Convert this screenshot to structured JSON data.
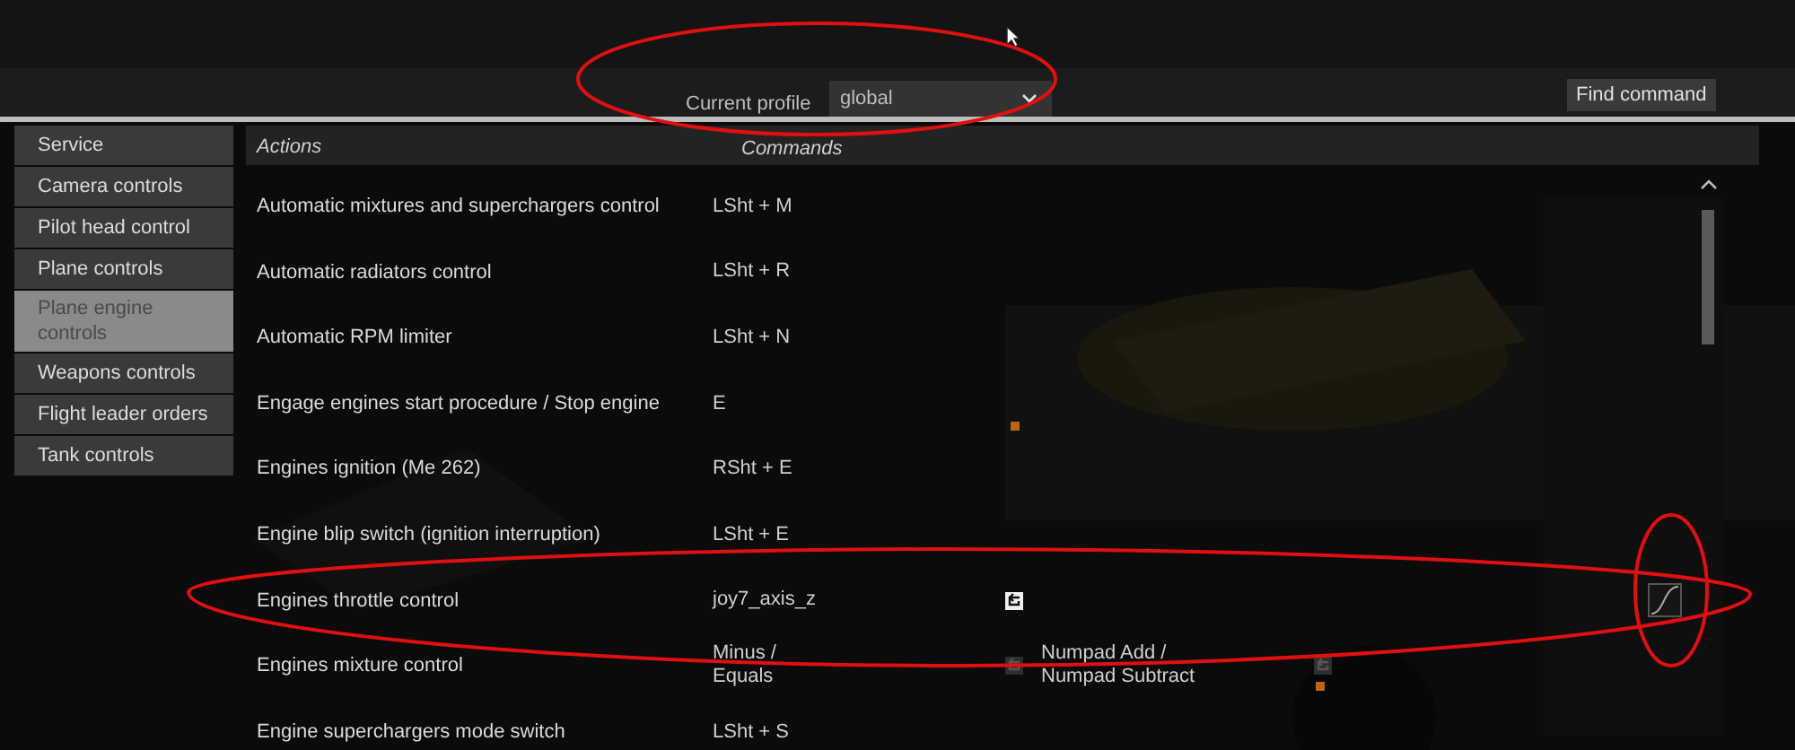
{
  "profile": {
    "label": "Current profile",
    "value": "global"
  },
  "find_button": "Find command",
  "sidebar": {
    "items": [
      {
        "label": "Service",
        "selected": false
      },
      {
        "label": "Camera controls",
        "selected": false
      },
      {
        "label": "Pilot head control",
        "selected": false
      },
      {
        "label": "Plane controls",
        "selected": false
      },
      {
        "label": "Plane engine controls",
        "selected": true
      },
      {
        "label": "Weapons controls",
        "selected": false
      },
      {
        "label": "Flight leader orders",
        "selected": false
      },
      {
        "label": "Tank controls",
        "selected": false
      }
    ]
  },
  "table": {
    "columns": [
      "Actions",
      "Commands"
    ],
    "rows": [
      {
        "action": "Automatic mixtures and superchargers control",
        "commands": [
          {
            "text": "LSht + M"
          }
        ]
      },
      {
        "action": "Automatic radiators control",
        "commands": [
          {
            "text": "LSht + R"
          }
        ]
      },
      {
        "action": "Automatic RPM limiter",
        "commands": [
          {
            "text": "LSht + N"
          }
        ]
      },
      {
        "action": "Engage engines start procedure / Stop engine",
        "commands": [
          {
            "text": "E"
          }
        ]
      },
      {
        "action": "Engines ignition (Me 262)",
        "commands": [
          {
            "text": "RSht + E"
          }
        ]
      },
      {
        "action": "Engine blip switch (ignition interruption)",
        "commands": [
          {
            "text": "LSht + E"
          }
        ]
      },
      {
        "action": "Engines throttle control",
        "commands": [
          {
            "text": "joy7_axis_z",
            "inverted": true
          }
        ],
        "curve": true
      },
      {
        "action": "Engines mixture control",
        "commands": [
          {
            "text": "Minus / Equals",
            "inverted": false
          },
          {
            "text": "Numpad Add / Numpad Subtract",
            "inverted": false
          }
        ]
      },
      {
        "action": "Engine superchargers mode switch",
        "commands": [
          {
            "text": "LSht + S"
          }
        ]
      }
    ]
  }
}
